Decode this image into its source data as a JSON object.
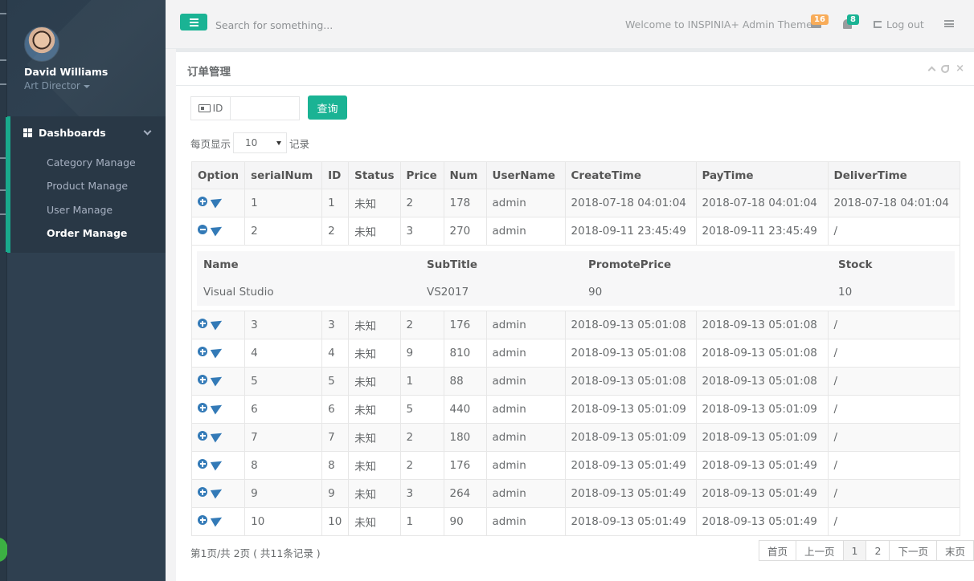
{
  "profile": {
    "name": "David Williams",
    "role": "Art Director"
  },
  "nav": {
    "section": "Dashboards",
    "items": [
      {
        "label": "Category Manage",
        "active": false
      },
      {
        "label": "Product Manage",
        "active": false
      },
      {
        "label": "User Manage",
        "active": false
      },
      {
        "label": "Order Manage",
        "active": true
      }
    ]
  },
  "topbar": {
    "search_placeholder": "Search for something...",
    "welcome": "Welcome to INSPINIA+ Admin Theme.",
    "messages_count": "16",
    "alerts_count": "8",
    "logout_label": "Log out"
  },
  "panel": {
    "title": "订单管理",
    "id_label": "ID",
    "id_value": "",
    "query_label": "查询",
    "perpage_prefix": "每页显示",
    "perpage_value": "10",
    "perpage_suffix": "记录"
  },
  "table": {
    "headers": [
      "Option",
      "serialNum",
      "ID",
      "Status",
      "Price",
      "Num",
      "UserName",
      "CreateTime",
      "PayTime",
      "DeliverTime"
    ],
    "rows": [
      [
        "1",
        "1",
        "未知",
        "2",
        "178",
        "admin",
        "2018-07-18 04:01:04",
        "2018-07-18 04:01:04",
        "2018-07-18 04:01:04"
      ],
      [
        "2",
        "2",
        "未知",
        "3",
        "270",
        "admin",
        "2018-09-11 23:45:49",
        "2018-09-11 23:45:49",
        "/"
      ],
      [
        "3",
        "3",
        "未知",
        "2",
        "176",
        "admin",
        "2018-09-13 05:01:08",
        "2018-09-13 05:01:08",
        "/"
      ],
      [
        "4",
        "4",
        "未知",
        "9",
        "810",
        "admin",
        "2018-09-13 05:01:08",
        "2018-09-13 05:01:08",
        "/"
      ],
      [
        "5",
        "5",
        "未知",
        "1",
        "88",
        "admin",
        "2018-09-13 05:01:08",
        "2018-09-13 05:01:08",
        "/"
      ],
      [
        "6",
        "6",
        "未知",
        "5",
        "440",
        "admin",
        "2018-09-13 05:01:09",
        "2018-09-13 05:01:09",
        "/"
      ],
      [
        "7",
        "7",
        "未知",
        "2",
        "180",
        "admin",
        "2018-09-13 05:01:09",
        "2018-09-13 05:01:09",
        "/"
      ],
      [
        "8",
        "8",
        "未知",
        "2",
        "176",
        "admin",
        "2018-09-13 05:01:49",
        "2018-09-13 05:01:49",
        "/"
      ],
      [
        "9",
        "9",
        "未知",
        "3",
        "264",
        "admin",
        "2018-09-13 05:01:49",
        "2018-09-13 05:01:49",
        "/"
      ],
      [
        "10",
        "10",
        "未知",
        "1",
        "90",
        "admin",
        "2018-09-13 05:01:49",
        "2018-09-13 05:01:49",
        "/"
      ]
    ],
    "expanded_row_index": 1,
    "detail": {
      "headers": [
        "Name",
        "SubTitle",
        "PromotePrice",
        "Stock"
      ],
      "row": [
        "Visual Studio",
        "VS2017",
        "90",
        "10"
      ]
    }
  },
  "pagination": {
    "info": "第1页/共 2页 ( 共11条记录 )",
    "buttons": [
      {
        "label": "首页",
        "active": false
      },
      {
        "label": "上一页",
        "active": false
      },
      {
        "label": "1",
        "active": true
      },
      {
        "label": "2",
        "active": false
      },
      {
        "label": "下一页",
        "active": false
      },
      {
        "label": "末页",
        "active": false
      }
    ]
  },
  "colors": {
    "accent": "#1ab394",
    "sidebar": "#2f4050",
    "icon_blue": "#337ab7",
    "badge_warning": "#f8ac59"
  }
}
